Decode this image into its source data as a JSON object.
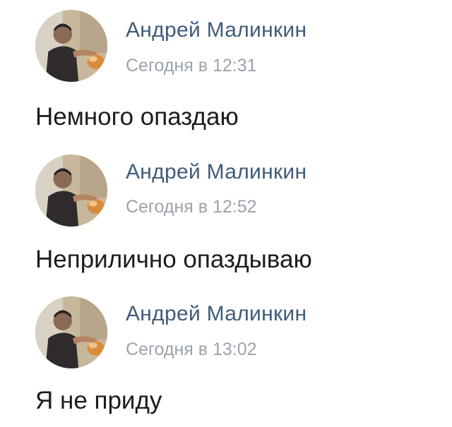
{
  "posts": [
    {
      "author": "Андрей Малинкин",
      "timestamp": "Сегодня в 12:31",
      "message": "Немного опаздаю",
      "avatar_icon": "user-photo-avatar"
    },
    {
      "author": "Андрей Малинкин",
      "timestamp": "Сегодня в 12:52",
      "message": "Неприлично опаздываю",
      "avatar_icon": "user-photo-avatar"
    },
    {
      "author": "Андрей Малинкин",
      "timestamp": "Сегодня в 13:02",
      "message": "Я не приду",
      "avatar_icon": "user-photo-avatar"
    }
  ],
  "colors": {
    "author": "#3f5b79",
    "timestamp": "#9ba3ab",
    "message": "#1c1c1c",
    "background": "#ffffff"
  }
}
